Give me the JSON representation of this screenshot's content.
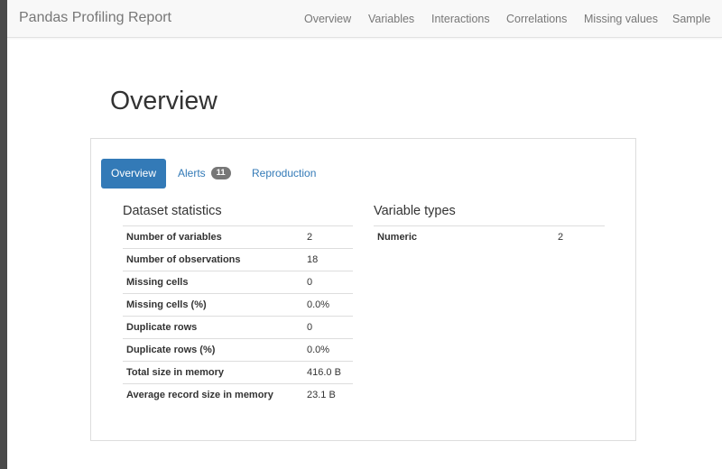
{
  "navbar": {
    "brand": "Pandas Profiling Report",
    "links": [
      "Overview",
      "Variables",
      "Interactions",
      "Correlations",
      "Missing values",
      "Sample"
    ]
  },
  "page_title": "Overview",
  "tabs": {
    "overview": "Overview",
    "alerts": "Alerts",
    "alerts_count": "11",
    "reproduction": "Reproduction"
  },
  "dataset_statistics": {
    "title": "Dataset statistics",
    "rows": [
      {
        "label": "Number of variables",
        "value": "2"
      },
      {
        "label": "Number of observations",
        "value": "18"
      },
      {
        "label": "Missing cells",
        "value": "0"
      },
      {
        "label": "Missing cells (%)",
        "value": "0.0%"
      },
      {
        "label": "Duplicate rows",
        "value": "0"
      },
      {
        "label": "Duplicate rows (%)",
        "value": "0.0%"
      },
      {
        "label": "Total size in memory",
        "value": "416.0 B"
      },
      {
        "label": "Average record size in memory",
        "value": "23.1 B"
      }
    ]
  },
  "variable_types": {
    "title": "Variable types",
    "rows": [
      {
        "label": "Numeric",
        "value": "2"
      }
    ]
  },
  "colors": {
    "accent": "#337ab7",
    "navbar_bg": "#f8f8f8",
    "badge_bg": "#777777"
  }
}
